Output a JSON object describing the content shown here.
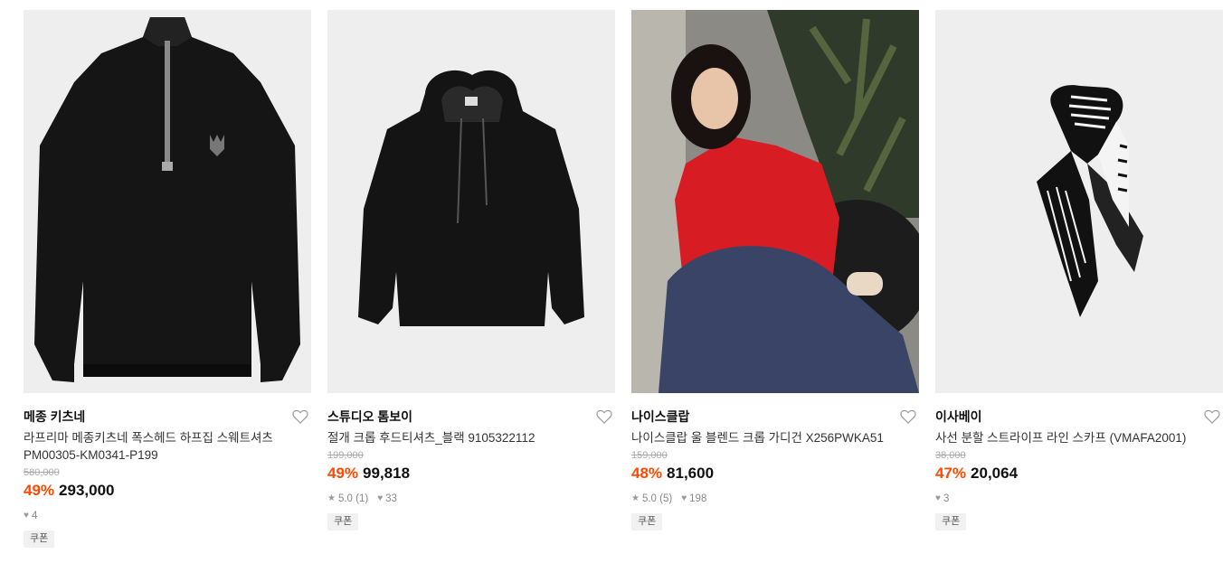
{
  "products": [
    {
      "brand": "메종 키츠네",
      "name_line1": "라프리마 메종키츠네 폭스헤드 하프집 스웨트셔츠",
      "name_line2": "PM00305-KM0341-P199",
      "original_price": "580,000",
      "discount": "49%",
      "price": "293,000",
      "rating": "",
      "likes": "4",
      "coupon": "쿠폰",
      "image_icon": "half-zip-sweatshirt-image"
    },
    {
      "brand": "스튜디오 톰보이",
      "name_line1": "절개 크롭 후드티셔츠_블랙 9105322112",
      "name_line2": "",
      "original_price": "199,000",
      "discount": "49%",
      "price": "99,818",
      "rating": "5.0 (1)",
      "likes": "33",
      "coupon": "쿠폰",
      "image_icon": "cropped-hoodie-image"
    },
    {
      "brand": "나이스클랍",
      "name_line1": "나이스클랍 울 블렌드 크롭 가디건 X256PWKA51",
      "name_line2": "",
      "original_price": "159,000",
      "discount": "48%",
      "price": "81,600",
      "rating": "5.0 (5)",
      "likes": "198",
      "coupon": "쿠폰",
      "image_icon": "model-red-cardigan-photo"
    },
    {
      "brand": "이사베이",
      "name_line1": "사선 분할 스트라이프 라인 스카프 (VMAFA2001)",
      "name_line2": "",
      "original_price": "38,000",
      "discount": "47%",
      "price": "20,064",
      "rating": "",
      "likes": "3",
      "coupon": "쿠폰",
      "image_icon": "striped-scarf-image"
    }
  ],
  "icons": {
    "heart": "heart-outline-icon",
    "star": "star-icon",
    "like": "heart-filled-icon"
  },
  "colors": {
    "discount": "#ff4800",
    "image_bg": "#eeeeee"
  }
}
